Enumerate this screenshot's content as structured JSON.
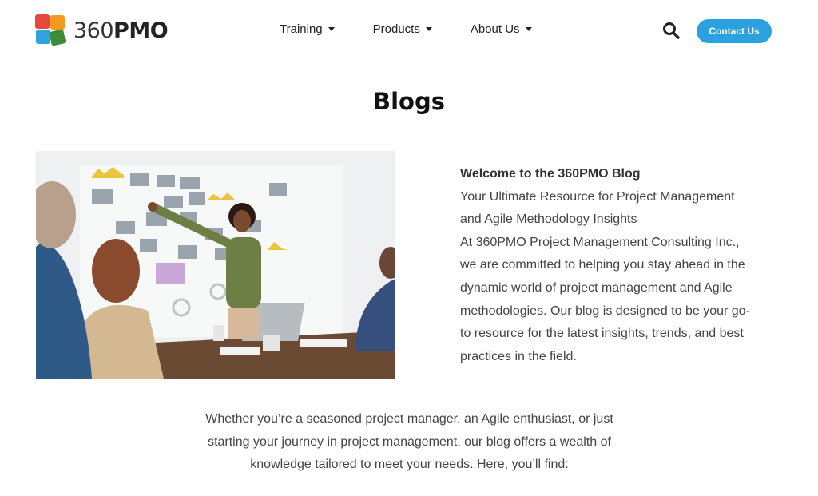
{
  "brand": {
    "name_light": "360",
    "name_bold": "PMO"
  },
  "nav": {
    "items": [
      {
        "label": "Training"
      },
      {
        "label": "Products"
      },
      {
        "label": "About Us"
      }
    ]
  },
  "header": {
    "contact_label": "Contact Us",
    "search_icon": "search-icon"
  },
  "page": {
    "title": "Blogs"
  },
  "intro": {
    "lead": "Welcome to the 360PMO Blog",
    "subtitle": "Your Ultimate Resource for Project Management and Agile Methodology Insights",
    "body": "At 360PMO Project Management Consulting Inc., we are committed to helping you stay ahead in the dynamic world of project management and Agile methodologies. Our blog is designed to be your go-to resource for the latest insights, trends, and best practices in the field."
  },
  "content": {
    "paragraph": "Whether you’re a seasoned project manager, an Agile enthusiast, or just starting your journey in project management, our blog offers a wealth of knowledge tailored to meet your needs. Here, you’ll find:"
  },
  "colors": {
    "accent": "#2ba2e0",
    "logo": [
      "#e5483d",
      "#f29b23",
      "#2fa3dd",
      "#3c8c3a"
    ]
  }
}
